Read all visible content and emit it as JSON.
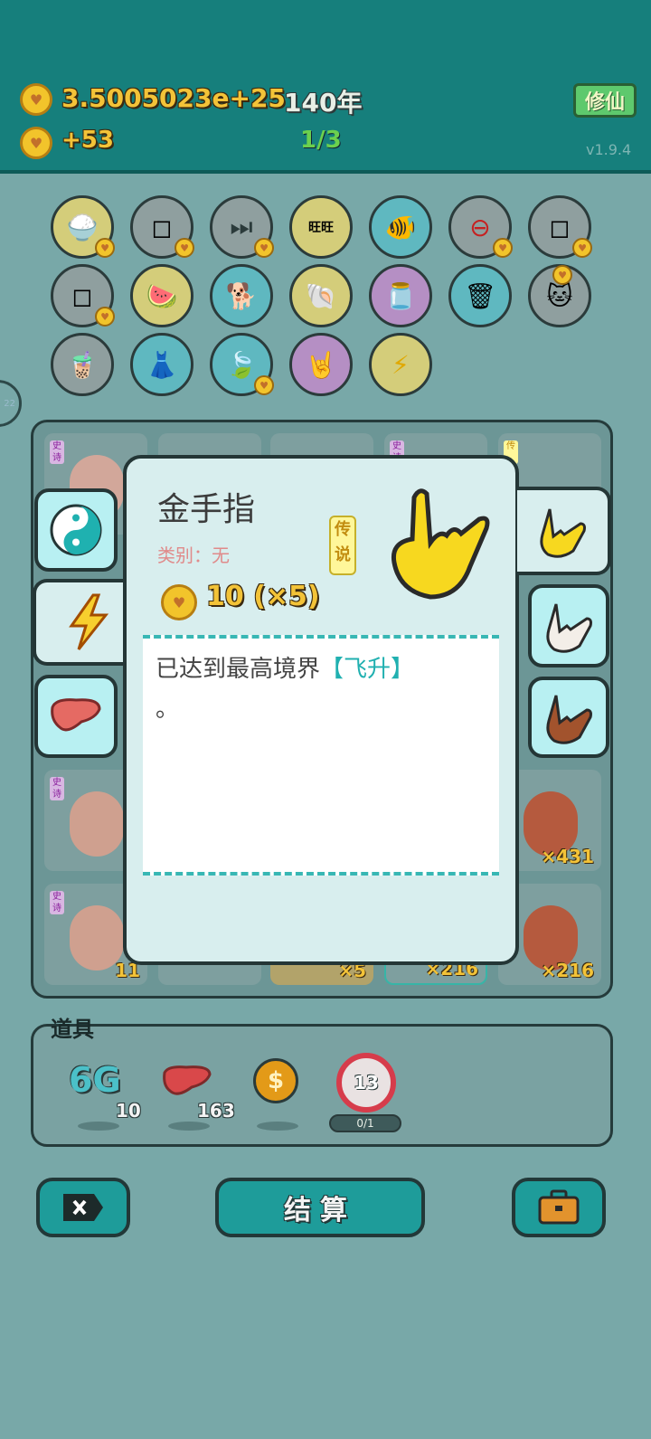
{
  "header": {
    "coins": "3.5005023e+25",
    "years": "140年",
    "income": "+53",
    "progress": "1/3",
    "version": "v1.9.4",
    "xiuxian_label": "修仙"
  },
  "side_tab": {
    "label": "22"
  },
  "grid": {
    "tag_label": "史诗",
    "tag_alt": "传",
    "counts": [
      "11",
      "×431",
      "×5",
      "×216",
      "×216",
      "11"
    ]
  },
  "popup": {
    "title": "金手指",
    "category": "类别：无",
    "badge": "传说",
    "price": "10 (×5)",
    "desc_prefix": "已达到最高境界",
    "desc_highlight": "【飞升】",
    "desc_suffix": "。"
  },
  "props": {
    "label": "道具",
    "sixg_label": "6G",
    "sixg_count": "10",
    "liver_count": "163",
    "coin_symbol": "$",
    "target_value": "13",
    "target_progress": "0/1"
  },
  "buttons": {
    "settle": "结算"
  },
  "colors": {
    "header_bg": "#167f7c",
    "board_bg": "#78a8a8",
    "gold_text": "#f3c338",
    "popup_bg": "#d8eeee",
    "highlight": "#20b0b0"
  }
}
